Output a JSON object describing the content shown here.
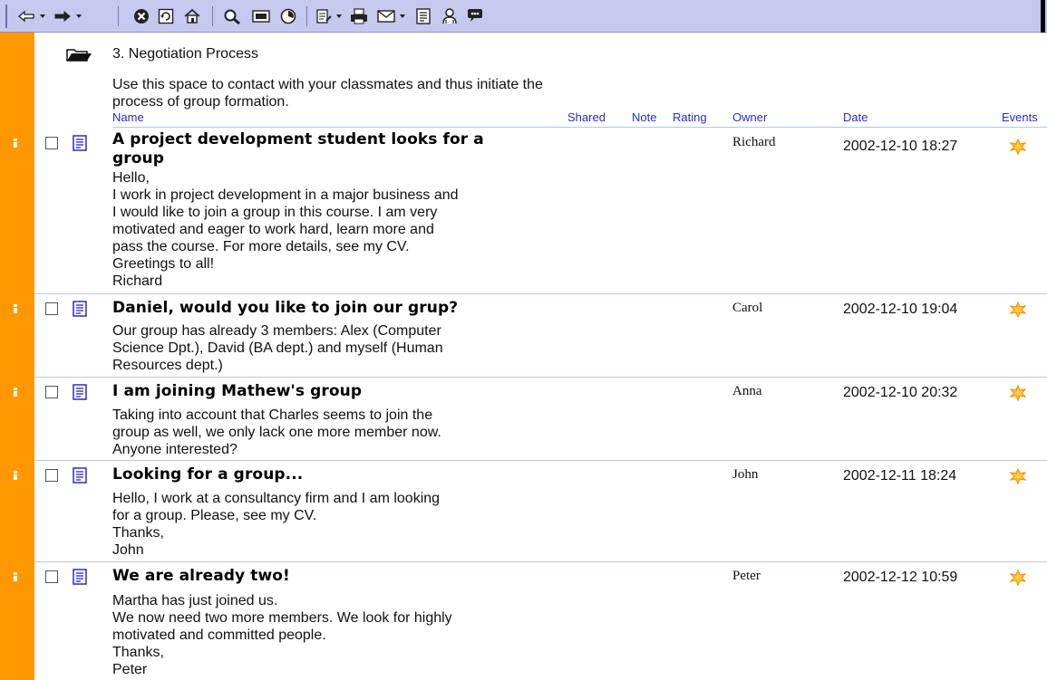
{
  "folder": {
    "title": "3. Negotiation Process",
    "description": "Use this space to contact with your classmates and thus initiate the process of group formation."
  },
  "columns": {
    "name": "Name",
    "shared": "Shared",
    "note": "Note",
    "rating": "Rating",
    "owner": "Owner",
    "date": "Date",
    "events": "Events"
  },
  "toolbar": {
    "icons": [
      "back-arrow-icon",
      "forward-arrow-icon",
      "stop-icon",
      "refresh-icon",
      "home-icon",
      "search-icon",
      "folder-view-icon",
      "history-icon",
      "edit-icon",
      "print-icon",
      "mail-icon",
      "page-icon",
      "users-icon",
      "discuss-icon"
    ]
  },
  "colors": {
    "rail": "#ff9800",
    "toolbar": "#c6c8ee",
    "header_text": "#2a2ad0",
    "event_icon": "#ff8c00"
  },
  "messages": [
    {
      "subject_line1": "A project development student looks for a",
      "subject_line2": "group",
      "body": "Hello,\nI work in project development in a major business and\nI would like to join a group in this course. I am very\nmotivated and eager to work hard, learn more and\npass the course. For more details, see my CV.\nGreetings to all!\nRichard",
      "owner": "Richard",
      "date": "2002-12-10 18:27"
    },
    {
      "subject_line1": "Daniel, would you like to join our grup?",
      "body": "Our group has already 3 members: Alex (Computer\nScience Dpt.), David (BA dept.) and myself (Human\nResources dept.)",
      "owner": "Carol",
      "date": "2002-12-10  19:04"
    },
    {
      "subject_line1": "I am joining Mathew's group",
      "body": "Taking into account that Charles seems to join the\ngroup as well, we only lack one more member now.\nAnyone interested?",
      "owner": "Anna",
      "date": "2002-12-10  20:32"
    },
    {
      "subject_line1": "Looking for a group...",
      "body": "Hello, I work at a consultancy firm and I am looking\nfor a group. Please, see my CV.\nThanks,\nJohn",
      "owner": "John",
      "date": "2002-12-11  18:24"
    },
    {
      "subject_line1": "We are already two!",
      "body": "Martha has just joined us.\nWe now need two more members. We look for highly\nmotivated and committed people.\nThanks,\nPeter",
      "owner": "Peter",
      "date": "2002-12-12  10:59"
    }
  ]
}
